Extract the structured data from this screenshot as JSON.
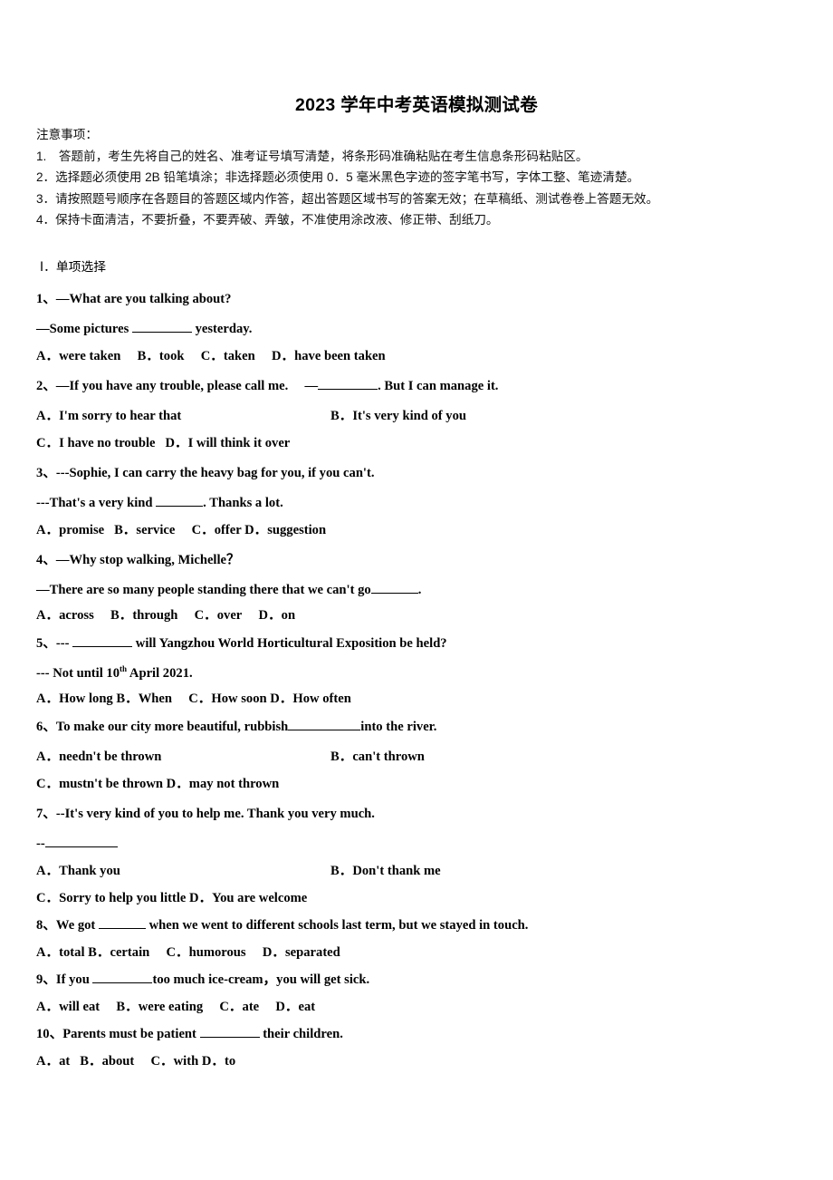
{
  "title": "2023 学年中考英语模拟测试卷",
  "notice": {
    "heading": "注意事项：",
    "lines": [
      "1.　答题前，考生先将自己的姓名、准考证号填写清楚，将条形码准确粘贴在考生信息条形码粘贴区。",
      "2．选择题必须使用 2B 铅笔填涂；非选择题必须使用 0．5 毫米黑色字迹的签字笔书写，字体工整、笔迹清楚。",
      "3．请按照题号顺序在各题目的答题区域内作答，超出答题区域书写的答案无效；在草稿纸、测试卷卷上答题无效。",
      "4．保持卡面清洁，不要折叠，不要弄破、弄皱，不准使用涂改液、修正带、刮纸刀。"
    ]
  },
  "section": {
    "heading": "Ⅰ．单项选择"
  },
  "questions": [
    {
      "number": "1、",
      "stem_a": "—What are you talking about?",
      "stem_b_pre": "—Some pictures ",
      "stem_b_post": " yesterday.",
      "options_line1": "A．were taken  B．took  C．taken  D．have been taken"
    },
    {
      "number": "2、",
      "stem_pre": "—If you have any trouble, please call me.　 —",
      "stem_post": ". But I can manage it.",
      "options_line1": "A．I'm sorry to hear that",
      "options_line1b": "B．It's very kind of you",
      "options_line2": "C．I have no trouble  D．I will think it over"
    },
    {
      "number": "3、",
      "stem_a": "---Sophie, I can carry the heavy bag for you, if you can't.",
      "stem_b_pre": "---That's a very kind ",
      "stem_b_post": ". Thanks a lot.",
      "options_line1": "A．promise  B．service  C．offer D．suggestion"
    },
    {
      "number": "4、",
      "stem_a": "—Why stop walking, Michelle？",
      "stem_b_pre": "—There are so many people standing there that we can't go",
      "stem_b_post": ".",
      "options_line1": "A．across  B．through  C．over  D．on"
    },
    {
      "number": "5、",
      "stem_pre": "--- ",
      "stem_post": " will Yangzhou World Horticultural Exposition be held?",
      "answer_pre": "--- Not until 10",
      "answer_sup": "th",
      "answer_post": " April 2021.",
      "options_line1": "A．How long B．When  C．How soon D．How often"
    },
    {
      "number": "6、",
      "stem_pre": "To make our city more beautiful, rubbish",
      "stem_post": "into the river.",
      "options_line1": "A．needn't be thrown",
      "options_line1b": "B．can't thrown",
      "options_line2": "C．mustn't be thrown D．may not thrown"
    },
    {
      "number": "7、",
      "stem_a": "--It's very kind of you to help me. Thank you very much.",
      "stem_b_pre": "--",
      "options_line1": "A．Thank you",
      "options_line1b": "B．Don't thank me",
      "options_line2": "C．Sorry to help you little  D．You are welcome"
    },
    {
      "number": "8、",
      "stem_pre": "We got ",
      "stem_post": " when we went to different schools last term, but we stayed in touch.",
      "options_line1": "A．total B．certain  C．humorous  D．separated"
    },
    {
      "number": "9、",
      "stem_pre": "If you ",
      "stem_post": "too much ice-cream，you will get sick.",
      "options_line1": "A．will eat  B．were eating  C．ate  D．eat"
    },
    {
      "number": "10、",
      "stem_pre": "Parents must be patient ",
      "stem_post": " their children.",
      "options_line1": "A．at  B．about  C．with D．to"
    }
  ]
}
